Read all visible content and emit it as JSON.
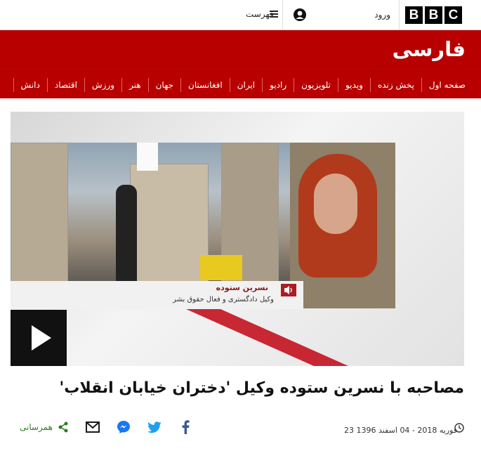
{
  "header": {
    "brand_letters": [
      "B",
      "B",
      "C"
    ],
    "login_label": "ورود",
    "menu_label": "فهرست",
    "user_icon": "user-icon",
    "menu_icon": "hamburger-icon"
  },
  "brand": {
    "title": "فارسی"
  },
  "nav": {
    "items": [
      {
        "label": "صفحه اول"
      },
      {
        "label": "پخش زنده"
      },
      {
        "label": "ویدیو"
      },
      {
        "label": "تلویزیون"
      },
      {
        "label": "رادیو"
      },
      {
        "label": "ایران"
      },
      {
        "label": "افغانستان"
      },
      {
        "label": "جهان"
      },
      {
        "label": "هنر"
      },
      {
        "label": "ورزش"
      },
      {
        "label": "اقتصاد"
      },
      {
        "label": "دانش"
      }
    ]
  },
  "media": {
    "caption_name": "نسرین ستوده",
    "caption_role": "وکیل دادگستری و فعال حقوق بشر",
    "play_icon": "play-icon"
  },
  "article": {
    "headline": "مصاحبه با نسرین ستوده وکیل 'دختران خیابان انقلاب'",
    "date": "23 فوریه 2018 - 04 اسفند 1396",
    "share_label": "همرسانی"
  },
  "colors": {
    "brand_red": "#b80000",
    "share_green": "#2c7d1f"
  }
}
